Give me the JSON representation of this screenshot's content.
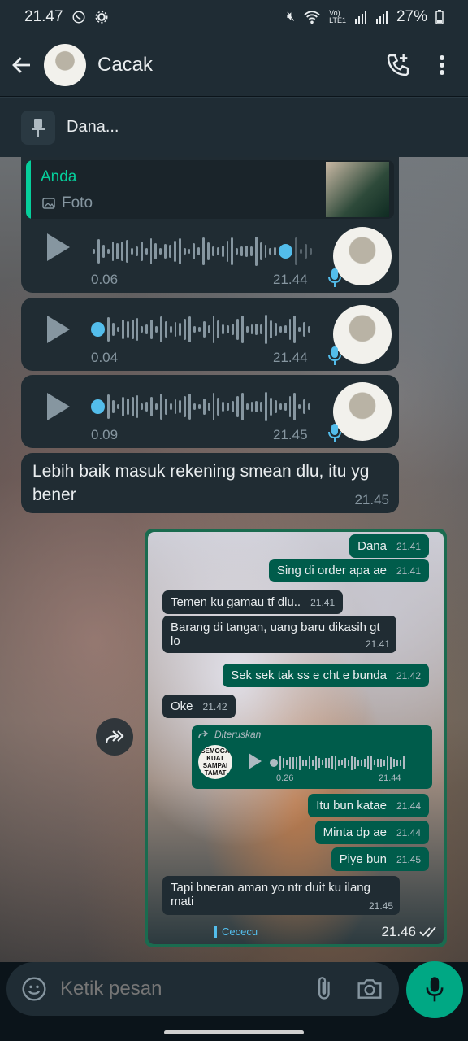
{
  "status": {
    "time": "21.47",
    "battery": "27%",
    "network_label_top": "Vo)",
    "network_label_bottom": "LTE1"
  },
  "header": {
    "contact_name": "Cacak"
  },
  "pinned": {
    "text": "Dana..."
  },
  "reply": {
    "author": "Anda",
    "type": "Foto"
  },
  "voice_notes": [
    {
      "duration": "0.06",
      "time": "21.44",
      "progress": 0.9
    },
    {
      "duration": "0.04",
      "time": "21.44",
      "progress": 0.0
    },
    {
      "duration": "0.09",
      "time": "21.45",
      "progress": 0.0
    }
  ],
  "text_message": {
    "text": "Lebih baik masuk rekening smean dlu, itu yg bener",
    "time": "21.45"
  },
  "forwarded_screenshot": {
    "time": "21.46",
    "footer_label": "Cececu",
    "messages": [
      {
        "dir": "out",
        "text": "Dana",
        "time": "21.41"
      },
      {
        "dir": "out",
        "text": "Sing di order apa ae",
        "time": "21.41"
      },
      {
        "dir": "in",
        "text": "Temen ku gamau tf dlu..",
        "time": "21.41"
      },
      {
        "dir": "in",
        "text": "Barang di tangan, uang baru dikasih gt lo",
        "time": "21.41"
      },
      {
        "dir": "out",
        "text": "Sek sek tak ss e cht e bunda",
        "time": "21.42"
      },
      {
        "dir": "in",
        "text": "Oke",
        "time": "21.42"
      },
      {
        "dir": "out",
        "text": "Itu bun katae",
        "time": "21.44"
      },
      {
        "dir": "out",
        "text": "Minta dp ae",
        "time": "21.44"
      },
      {
        "dir": "out",
        "text": "Piye bun",
        "time": "21.45"
      },
      {
        "dir": "in",
        "text": "Tapi bneran aman yo ntr duit ku ilang mati",
        "time": "21.45"
      }
    ],
    "forwarded_audio": {
      "label": "Diteruskan",
      "duration": "0.26",
      "time": "21.44",
      "sticker_text": "SEMOGA KUAT SAMPAI TAMAT"
    }
  },
  "composer": {
    "placeholder": "Ketik pesan"
  },
  "colors": {
    "accent": "#00a884",
    "outgoing": "#005c4b",
    "incoming": "#202c33",
    "link_blue": "#53bdeb"
  }
}
